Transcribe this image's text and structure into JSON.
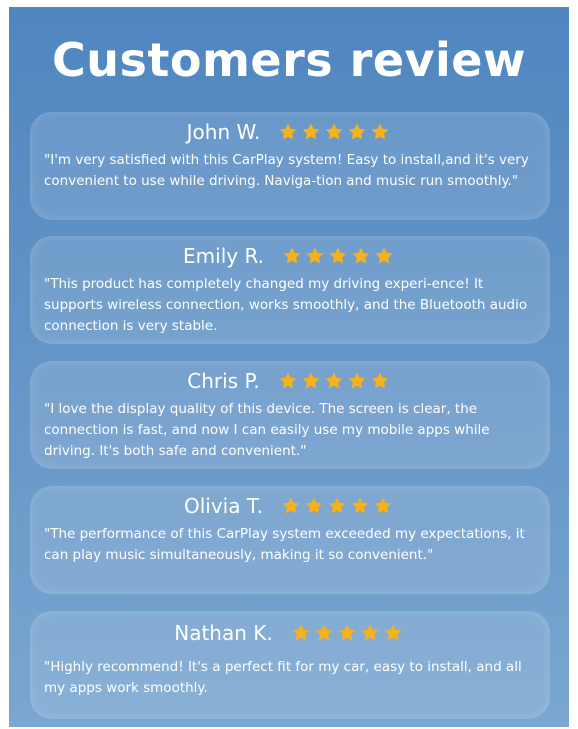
{
  "title": "Customers review",
  "star_color": "#f6b21a",
  "reviews": [
    {
      "name": "John W.",
      "rating": 5,
      "text": "\"I'm very satisfied with this CarPlay system! Easy to install,and it's very convenient to use while driving. Naviga-tion and music run smoothly.\""
    },
    {
      "name": "Emily R.",
      "rating": 5,
      "text": "\"This product has completely changed my driving experi-ence! It supports wireless connection, works smoothly, and the Bluetooth audio connection is very stable."
    },
    {
      "name": "Chris P.",
      "rating": 5,
      "text": "\"I love the display quality of this device. The screen is clear, the connection is fast, and now I can easily use my mobile apps while driving. It's both safe and convenient.\""
    },
    {
      "name": "Olivia T.",
      "rating": 5,
      "text": "\"The performance of this CarPlay system exceeded my expectations, it can play music simultaneously, making it so convenient.\""
    },
    {
      "name": "Nathan K.",
      "rating": 5,
      "text": "\"Highly recommend! It's a perfect fit for my car, easy to install, and all my apps work smoothly."
    }
  ]
}
